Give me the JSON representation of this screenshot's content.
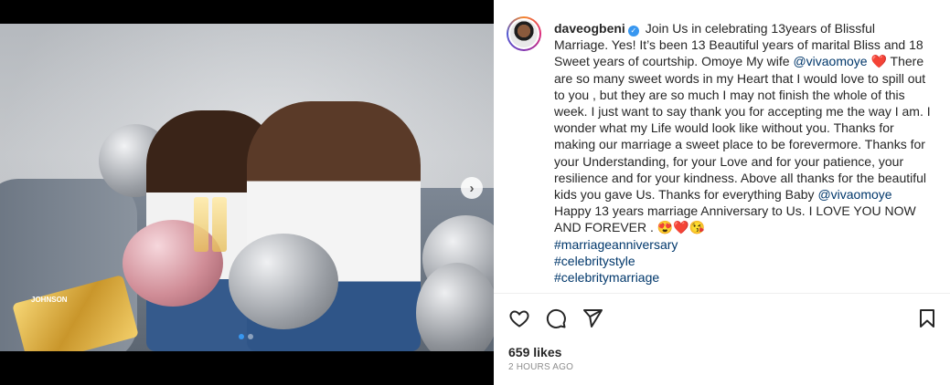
{
  "post": {
    "username": "daveogbeni",
    "verified_icon": "verified-badge-icon",
    "caption_parts": {
      "p1": "Join Us in celebrating 13years of Blissful Marriage. Yes! It’s been 13 Beautiful years of marital Bliss and 18 Sweet years of courtship. Omoye My wife",
      "mention1": "@vivaomoye",
      "heart": "❤️",
      "p2": "There are so many sweet words in my Heart that I would love to spill out to you , but they are so much I may not finish the whole of this week. I just want to say thank you for accepting me the way I am. I wonder what my Life would look like without you. Thanks for making our marriage a sweet place to be forevermore. Thanks for your Understanding, for your Love and for your patience, your resilience and for your kindness. Above all thanks for the beautiful kids you gave Us. Thanks for everything Baby",
      "mention2": "@vivaomoye",
      "p3": "Happy 13 years marriage Anniversary to Us. I LOVE YOU NOW AND FOREVER .",
      "emojis": "😍❤️😘"
    },
    "hashtags": [
      "#marriageanniversary",
      "#celebritystyle",
      "#celebritymarriage"
    ],
    "likes": "659 likes",
    "timestamp": "2 HOURS AGO"
  },
  "media": {
    "watermark": "JOHNSON",
    "carousel": {
      "count": 2,
      "active": 1
    },
    "next_icon": "chevron-right-icon"
  },
  "actions": {
    "like_icon": "heart-icon",
    "comment_icon": "comment-icon",
    "share_icon": "paper-plane-icon",
    "save_icon": "bookmark-icon"
  },
  "colors": {
    "link": "#00376b",
    "active_dot": "#3897f0",
    "verified": "#3897f0",
    "muted": "#8e8e8e"
  }
}
